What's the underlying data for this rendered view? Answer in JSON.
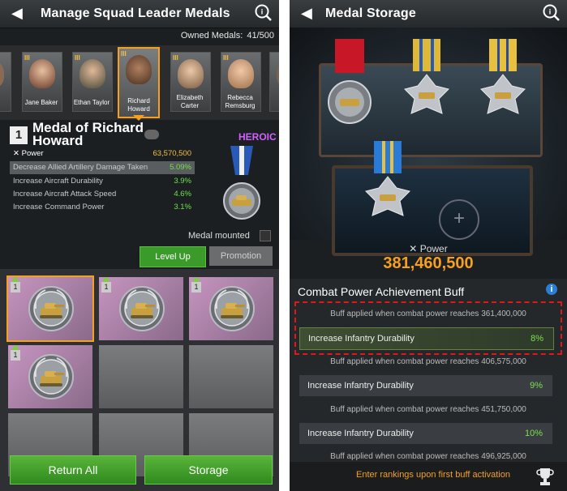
{
  "left": {
    "title": "Manage Squad Leader Medals",
    "owned_medals_label": "Owned Medals:",
    "owned_medals_value": "41/500",
    "portraits": [
      {
        "name": "Jane Baker"
      },
      {
        "name": "Ethan Taylor"
      },
      {
        "name": "Richard Howard"
      },
      {
        "name": "Elizabeth Carter"
      },
      {
        "name": "Rebecca Remsburg"
      }
    ],
    "medal": {
      "rank": "1",
      "name": "Medal of Richard Howard",
      "rarity": "HEROIC",
      "power_label": "Power",
      "power_value": "63,570,500",
      "stats": [
        {
          "label": "Decrease Allied Artillery Damage Taken",
          "value": "5.09%"
        },
        {
          "label": "Increase Aircraft Durability",
          "value": "3.9%"
        },
        {
          "label": "Increase Aircraft Attack Speed",
          "value": "4.6%"
        },
        {
          "label": "Increase Command Power",
          "value": "3.1%"
        }
      ]
    },
    "mounted_label": "Medal mounted",
    "level_up_label": "Level Up",
    "promotion_label": "Promotion",
    "inventory_badges": [
      "1",
      "1",
      "1",
      "1"
    ],
    "return_all_label": "Return All",
    "storage_label": "Storage"
  },
  "right": {
    "title": "Medal Storage",
    "power_label": "Power",
    "power_value": "381,460,500",
    "section_title": "Combat Power Achievement Buff",
    "buffs": [
      {
        "caption": "Buff applied when combat power reaches 361,400,000",
        "label": "Increase Infantry Durability",
        "value": "8%"
      },
      {
        "caption": "Buff applied when combat power reaches 406,575,000",
        "label": "Increase Infantry Durability",
        "value": "9%"
      },
      {
        "caption": "Buff applied when combat power reaches 451,750,000",
        "label": "Increase Infantry Durability",
        "value": "10%"
      },
      {
        "caption": "Buff applied when combat power reaches 496,925,000"
      }
    ],
    "rankings_note": "Enter rankings upon first buff activation"
  },
  "colors": {
    "accent_orange": "#f5a020",
    "stat_green": "#6ee04a",
    "heroic_purple": "#d060ff",
    "highlight_red": "#e01818"
  }
}
